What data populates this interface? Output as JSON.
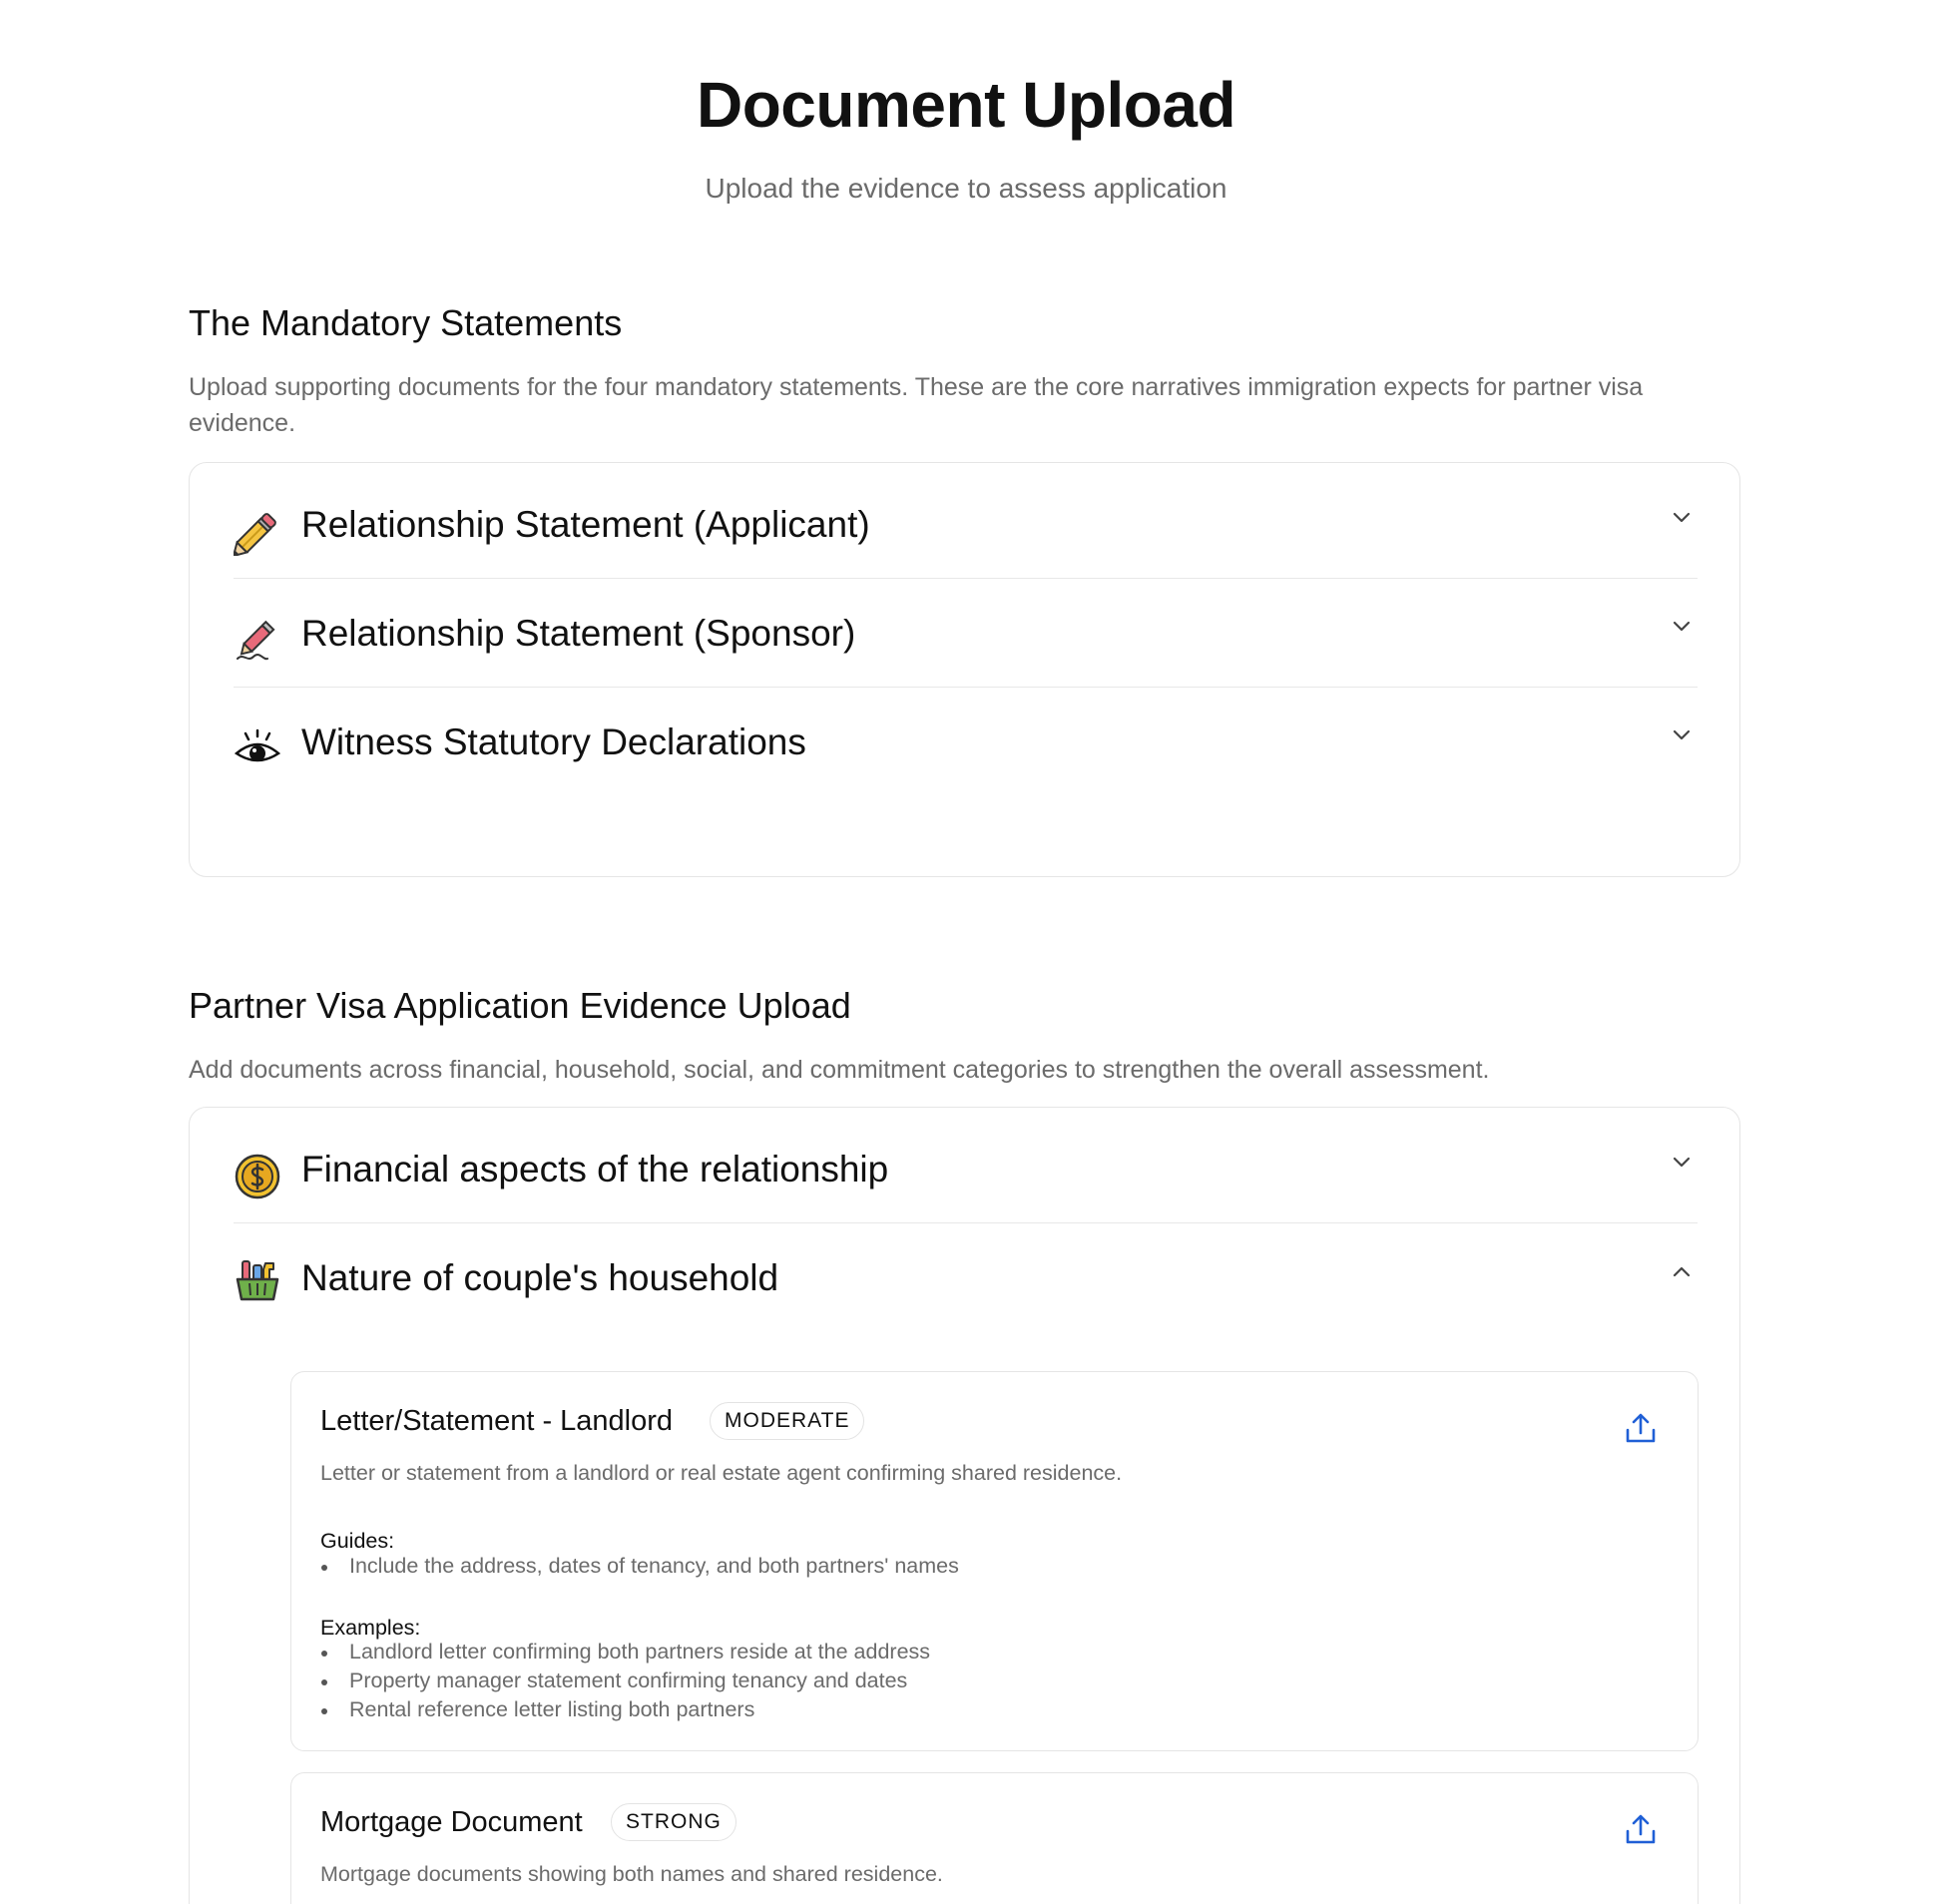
{
  "header": {
    "title": "Document Upload",
    "subtitle": "Upload the evidence to assess application"
  },
  "mandatory": {
    "title": "The Mandatory Statements",
    "description": "Upload supporting documents for the four mandatory statements. These are the core narratives immigration expects for partner visa evidence.",
    "items": [
      {
        "label": "Relationship Statement (Applicant)",
        "icon": "pencil-icon",
        "expanded": false
      },
      {
        "label": "Relationship Statement (Sponsor)",
        "icon": "pen-signature-icon",
        "expanded": false
      },
      {
        "label": "Witness Statutory Declarations",
        "icon": "eye-icon",
        "expanded": false
      }
    ]
  },
  "evidence": {
    "title": "Partner Visa Application Evidence Upload",
    "description": "Add documents across financial, household, social, and commitment categories to strengthen the overall assessment.",
    "categories": [
      {
        "label": "Financial aspects of the relationship",
        "icon": "coin-icon",
        "expanded": false
      },
      {
        "label": "Nature of couple's household",
        "icon": "cleaning-basket-icon",
        "expanded": true
      }
    ],
    "documents": [
      {
        "title": "Letter/Statement - Landlord",
        "badge": "MODERATE",
        "description": "Letter or statement from a landlord or real estate agent confirming shared residence.",
        "guides_label": "Guides:",
        "guides": [
          "Include the address, dates of tenancy, and both partners' names"
        ],
        "examples_label": "Examples:",
        "examples": [
          "Landlord letter confirming both partners reside at the address",
          "Property manager statement confirming tenancy and dates",
          "Rental reference letter listing both partners"
        ]
      },
      {
        "title": "Mortgage Document",
        "badge": "STRONG",
        "description": "Mortgage documents showing both names and shared residence."
      }
    ]
  },
  "colors": {
    "accent_blue": "#1f5fd6",
    "border": "#e5e5e5",
    "muted_text": "#6b6b6b"
  }
}
